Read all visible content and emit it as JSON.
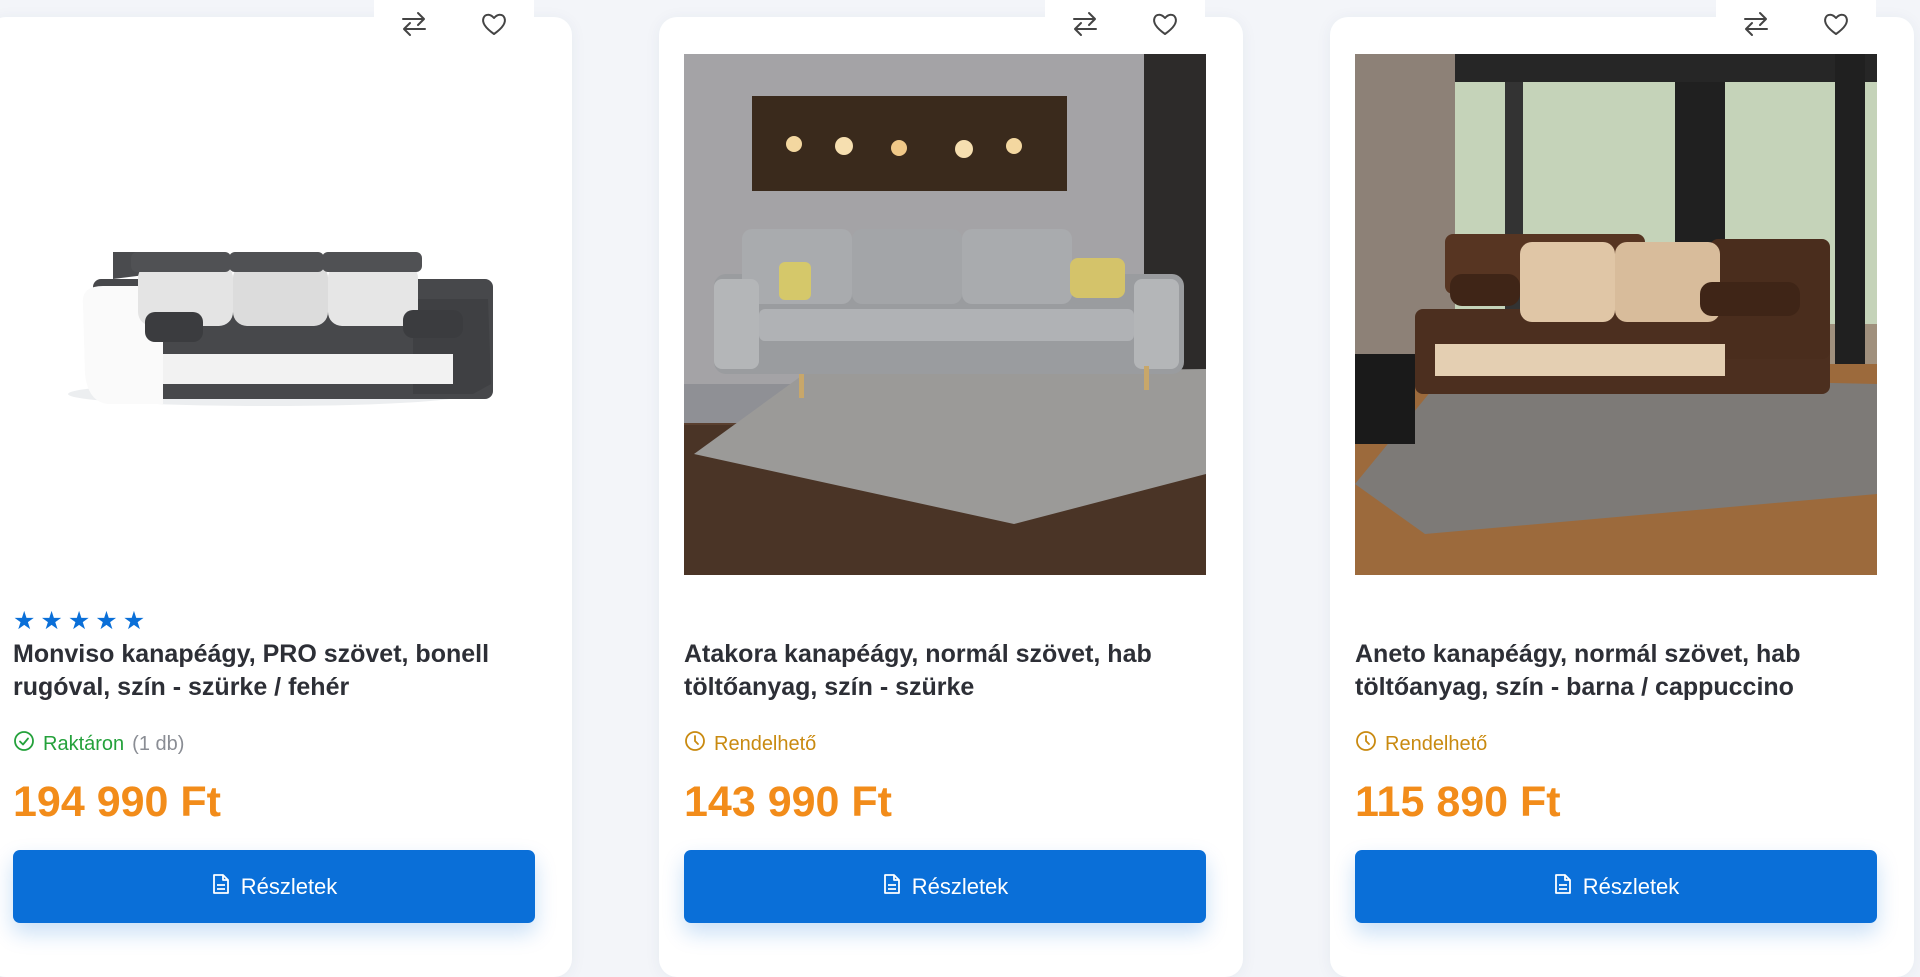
{
  "colors": {
    "primary_button": "#0a6fd8",
    "price": "#f28c1a",
    "in_stock": "#24a13b",
    "orderable": "#c98a10",
    "rating_star": "#0a6fd8"
  },
  "icons": {
    "compare": "arrows-left-right-icon",
    "wishlist": "heart-icon",
    "in_stock": "check-circle-icon",
    "orderable": "clock-icon",
    "details": "document-icon",
    "rating": "star-icon"
  },
  "products": [
    {
      "rating": 5,
      "title": "Monviso kanapéágy, PRO szövet, bonell rugóval, szín - szürke / fehér",
      "availability": "Raktáron",
      "availability_type": "in_stock",
      "quantity": "(1 db)",
      "price": "194 990 Ft",
      "button_label": "Részletek"
    },
    {
      "rating": 0,
      "title": "Atakora kanapéágy, normál szövet, hab töltőanyag, szín - szürke",
      "availability": "Rendelhető",
      "availability_type": "orderable",
      "quantity": "",
      "price": "143 990 Ft",
      "button_label": "Részletek"
    },
    {
      "rating": 0,
      "title": "Aneto kanapéágy, normál szövet, hab töltőanyag, szín - barna / cappuccino",
      "availability": "Rendelhető",
      "availability_type": "orderable",
      "quantity": "",
      "price": "115 890 Ft",
      "button_label": "Részletek"
    }
  ]
}
